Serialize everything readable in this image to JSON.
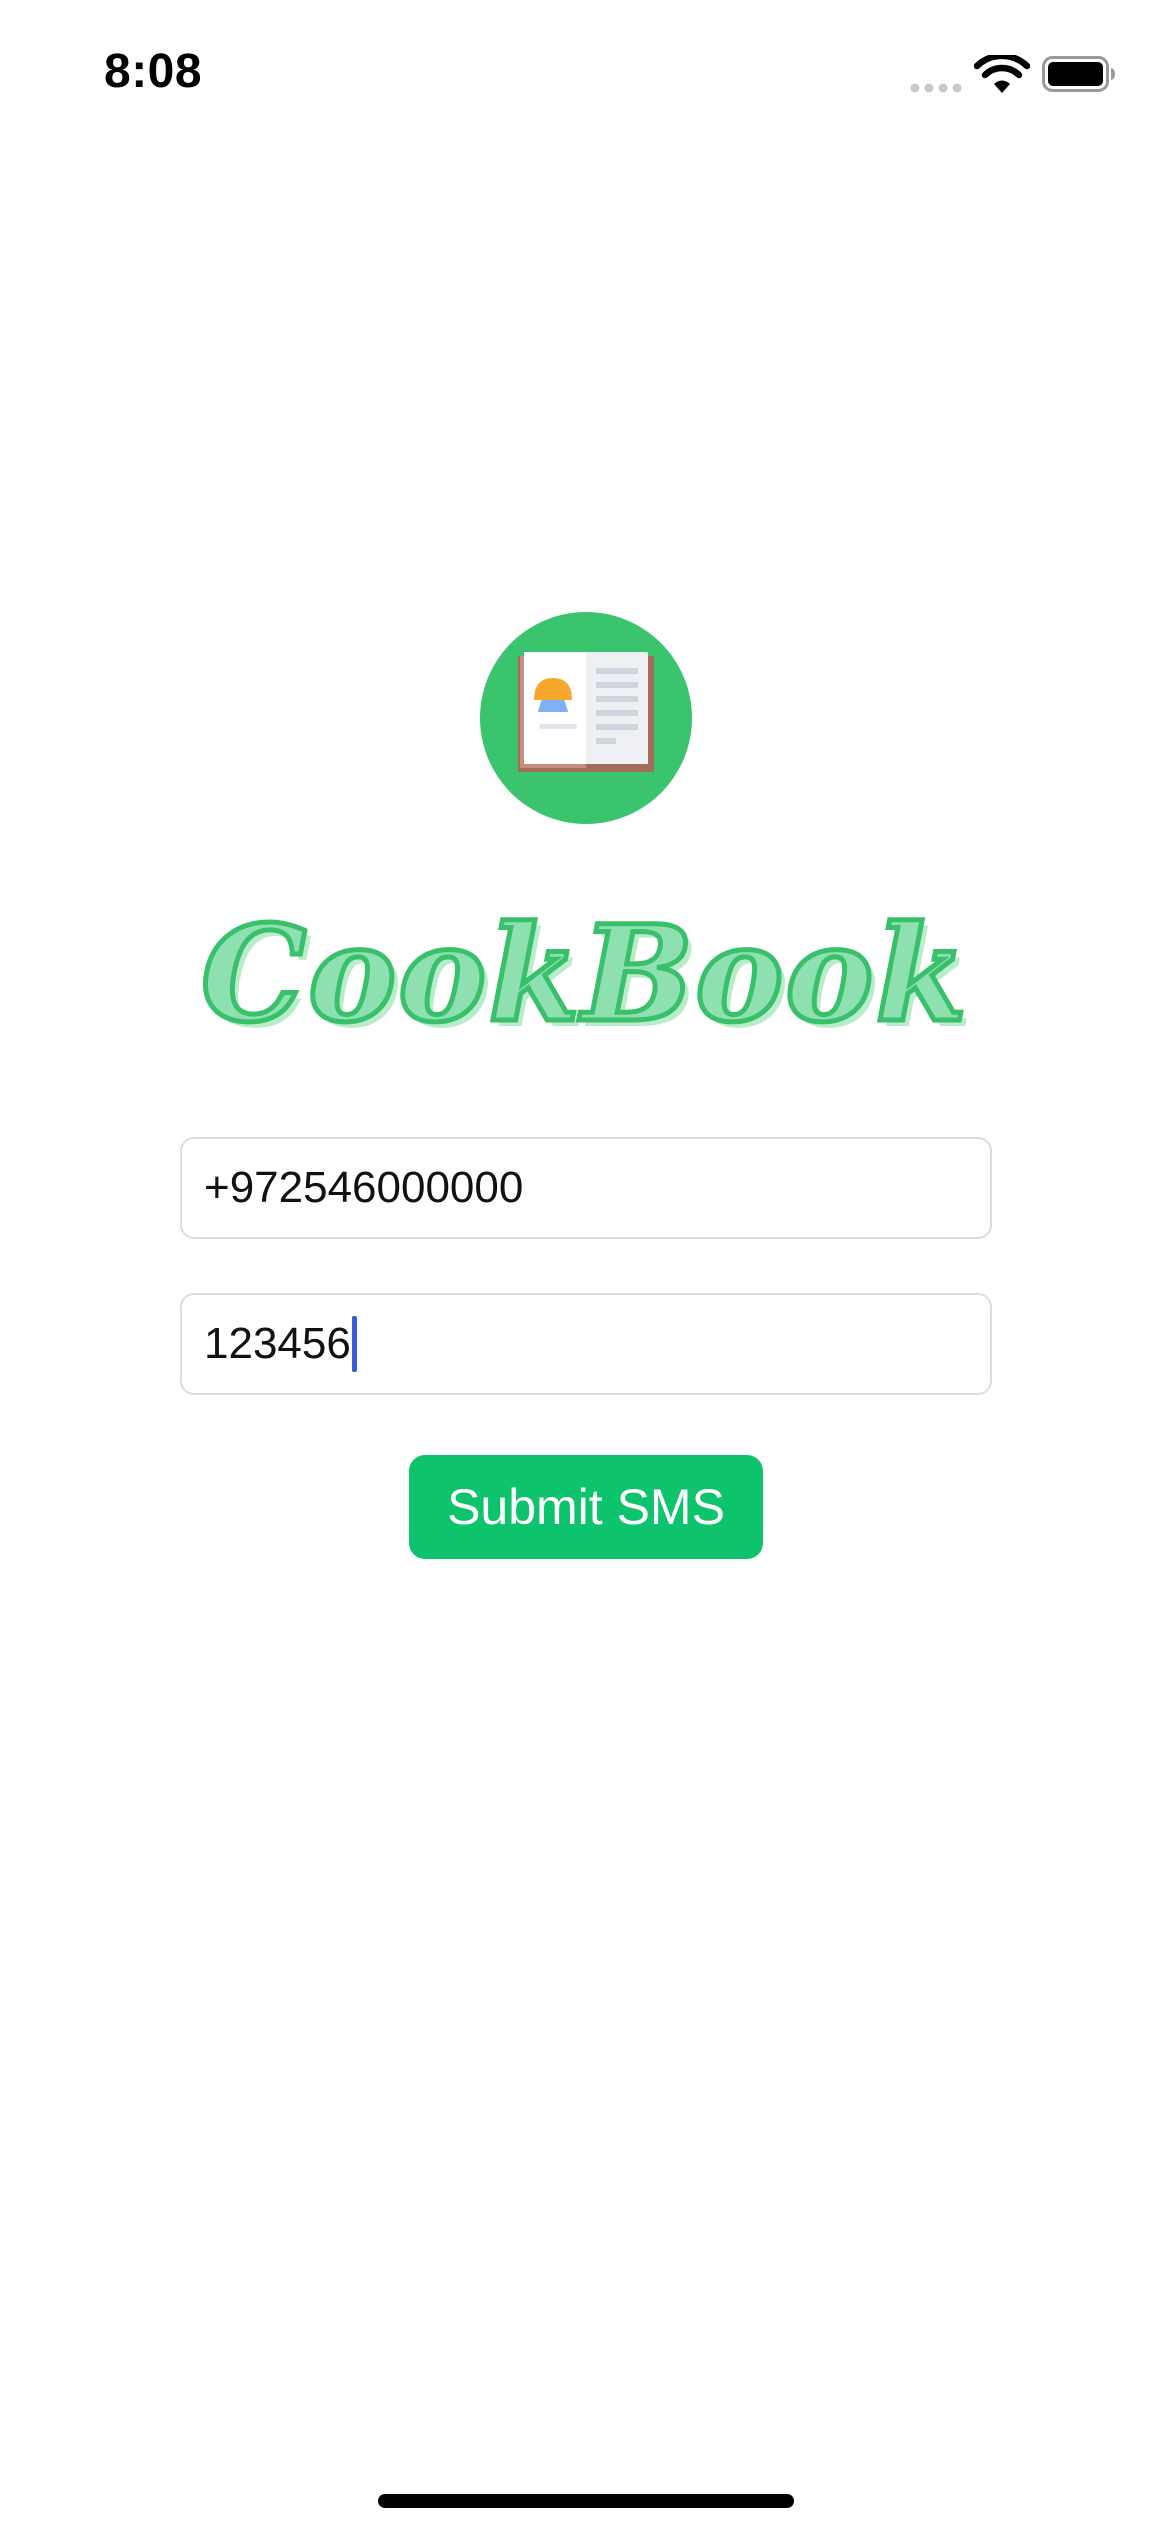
{
  "status_bar": {
    "time": "8:08",
    "icons": [
      "signal-dots-icon",
      "wifi-icon",
      "battery-icon"
    ]
  },
  "app": {
    "logo_icon": "cookbook-logo-icon",
    "title": "CookBook"
  },
  "form": {
    "phone_value": "+972546000000",
    "code_value": "123456",
    "submit_label": "Submit SMS"
  },
  "colors": {
    "accent_green": "#0dc46d",
    "logo_circle": "#3bc46e",
    "title_fill": "#8fe0b1",
    "title_stroke": "#39c06b",
    "caret": "#3b5bdb"
  }
}
